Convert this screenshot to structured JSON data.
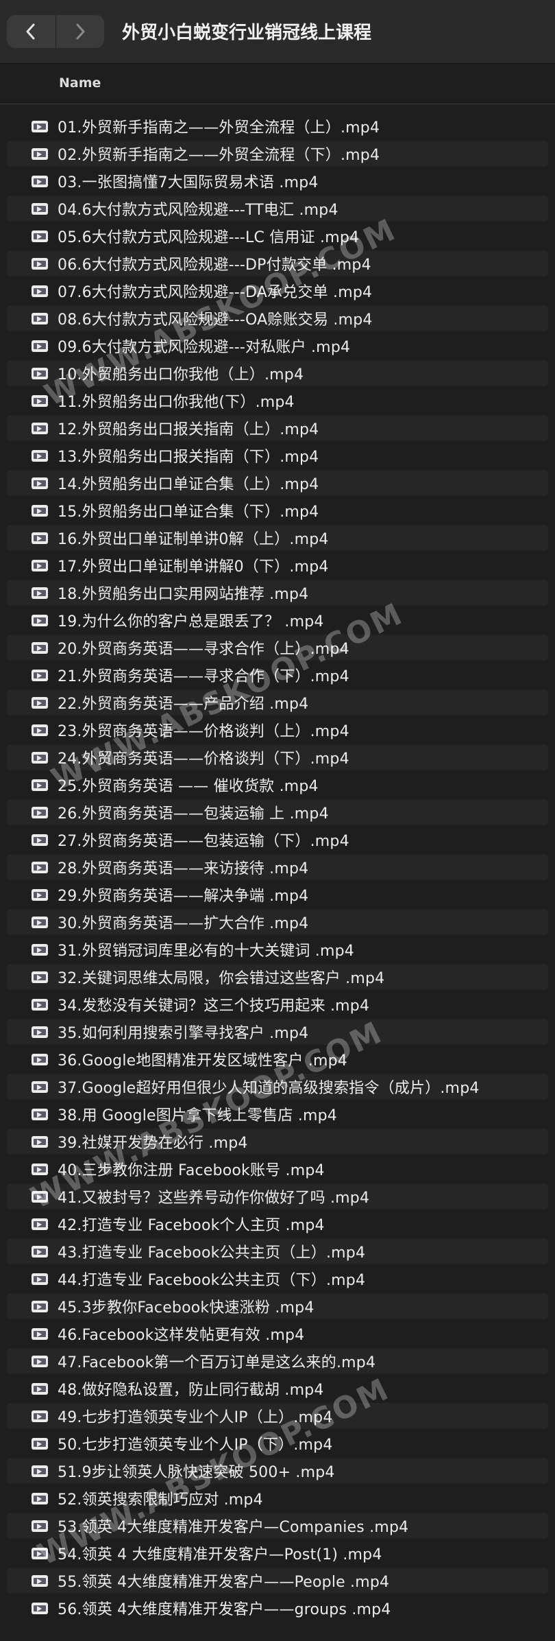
{
  "window": {
    "title": "外贸小白蜕变行业销冠线上课程"
  },
  "toolbar": {
    "back_icon": "chevron-left-icon",
    "forward_icon": "chevron-right-icon"
  },
  "columns": {
    "name": "Name"
  },
  "files": [
    "01.外贸新手指南之——外贸全流程（上）.mp4",
    "02.外贸新手指南之——外贸全流程（下）.mp4",
    "03.一张图搞懂7大国际贸易术语 .mp4",
    "04.6大付款方式风险规避---TT电汇 .mp4",
    "05.6大付款方式风险规避---LC 信用证 .mp4",
    "06.6大付款方式风险规避---DP付款交单 .mp4",
    "07.6大付款方式风险规避---DA承兑交单 .mp4",
    "08.6大付款方式风险规避---OA赊账交易 .mp4",
    "09.6大付款方式风险规避---对私账户 .mp4",
    "10.外贸船务出口你我他（上）.mp4",
    "11.外贸船务出口你我他(下）.mp4",
    "12.外贸船务出口报关指南（上）.mp4",
    "13.外贸船务出口报关指南（下）.mp4",
    "14.外贸船务出口单证合集（上）.mp4",
    "15.外贸船务出口单证合集（下）.mp4",
    "16.外贸出口单证制单讲0解（上）.mp4",
    "17.外贸出口单证制单讲解0（下）.mp4",
    "18.外贸船务出口实用网站推荐 .mp4",
    "19.为什么你的客户总是跟丢了？ .mp4",
    "20.外贸商务英语——寻求合作（上）.mp4",
    "21.外贸商务英语——寻求合作（下）.mp4",
    "22.外贸商务英语——产品介绍 .mp4",
    "23.外贸商务英语——价格谈判（上）.mp4",
    "24.外贸商务英语——价格谈判（下）.mp4",
    "25.外贸商务英语 —— 催收货款 .mp4",
    "26.外贸商务英语——包装运输 上 .mp4",
    "27.外贸商务英语——包装运输（下）.mp4",
    "28.外贸商务英语——来访接待 .mp4",
    "29.外贸商务英语——解决争端 .mp4",
    "30.外贸商务英语——扩大合作 .mp4",
    "31.外贸销冠词库里必有的十大关键词 .mp4",
    "32.关键词思维太局限，你会错过这些客户 .mp4",
    "34.发愁没有关键词？这三个技巧用起来 .mp4",
    "35.如何利用搜索引擎寻找客户 .mp4",
    "36.Google地图精准开发区域性客户 .mp4",
    "37.Google超好用但很少人知道的高级搜索指令（成片）.mp4",
    "38.用 Google图片拿下线上零售店 .mp4",
    "39.社媒开发势在必行 .mp4",
    "40.三步教你注册 Facebook账号 .mp4",
    "41.又被封号？这些养号动作你做好了吗 .mp4",
    "42.打造专业 Facebook个人主页 .mp4",
    "43.打造专业 Facebook公共主页（上）.mp4",
    "44.打造专业 Facebook公共主页（下）.mp4",
    "45.3步教你Facebook快速涨粉 .mp4",
    "46.Facebook这样发帖更有效 .mp4",
    "47.Facebook第一个百万订单是这么来的.mp4",
    "48.做好隐私设置，防止同行截胡 .mp4",
    "49.七步打造领英专业个人IP（上）.mp4",
    "50.七步打造领英专业个人IP（下）.mp4",
    "51.9步让领英人脉快速突破 500+ .mp4",
    "52.领英搜索限制巧应对 .mp4",
    "53.领英 4大维度精准开发客户—Companies .mp4",
    "54.领英 4 大维度精准开发客户—Post(1) .mp4",
    "55.领英 4大维度精准开发客户——People .mp4",
    "56.领英 4大维度精准开发客户——groups .mp4"
  ],
  "watermark": "WWW.ABSKOOP.COM"
}
